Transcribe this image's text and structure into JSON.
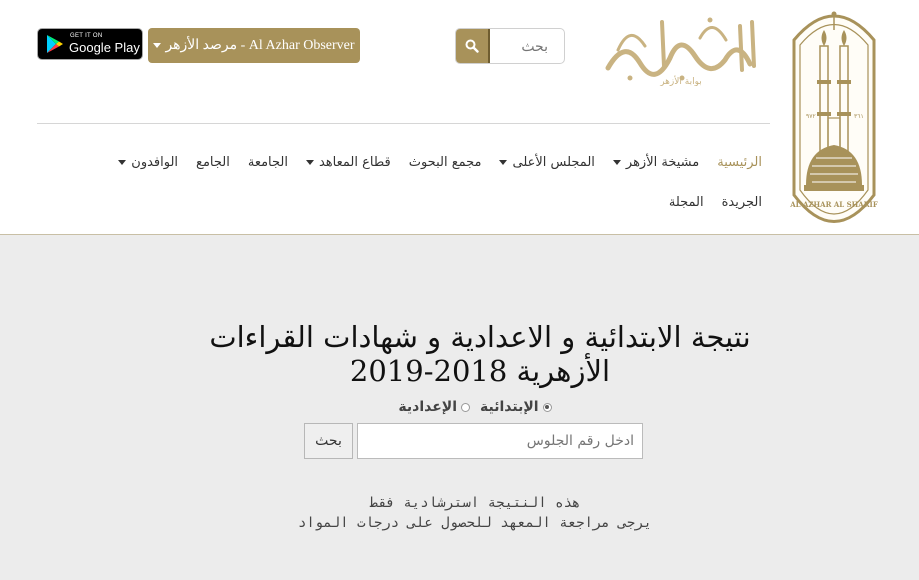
{
  "header": {
    "search": {
      "placeholder": "بحث"
    },
    "observer_button": {
      "label": "مرصد الأزهر - Al Azhar Observer"
    },
    "google_play": {
      "small": "GET IT ON",
      "big": "Google Play"
    },
    "brand_text": "بوابة الأزهر",
    "logo_text": "AL AZHAR AL SHARIF"
  },
  "nav": {
    "row1": [
      {
        "label": "الرئيسية",
        "active": true,
        "dropdown": false
      },
      {
        "label": "مشيخة الأزهر",
        "active": false,
        "dropdown": true
      },
      {
        "label": "المجلس الأعلى",
        "active": false,
        "dropdown": true
      },
      {
        "label": "مجمع البحوث",
        "active": false,
        "dropdown": false
      },
      {
        "label": "قطاع المعاهد",
        "active": false,
        "dropdown": true
      },
      {
        "label": "الجامعة",
        "active": false,
        "dropdown": false
      },
      {
        "label": "الجامع",
        "active": false,
        "dropdown": false
      },
      {
        "label": "الوافدون",
        "active": false,
        "dropdown": true
      }
    ],
    "row2": [
      {
        "label": "الجريدة"
      },
      {
        "label": "المجلة"
      }
    ]
  },
  "main": {
    "title_line1": "نتيجة الابتدائية و الاعدادية و شهادات القراءات",
    "title_line2": "الأزهرية 2018-2019",
    "radio_primary": "الإبتدائية",
    "radio_prep": "الإعدادية",
    "seat_placeholder": "ادخل رقم الجلوس",
    "search_label": "بحث",
    "note_line1": "هذه النتيجة استرشادية فقط",
    "note_line2": "يرجى مراجعة المعهد للحصول على درجات المواد"
  },
  "colors": {
    "accent": "#a8925a",
    "accent_dark": "#6f5d30"
  }
}
